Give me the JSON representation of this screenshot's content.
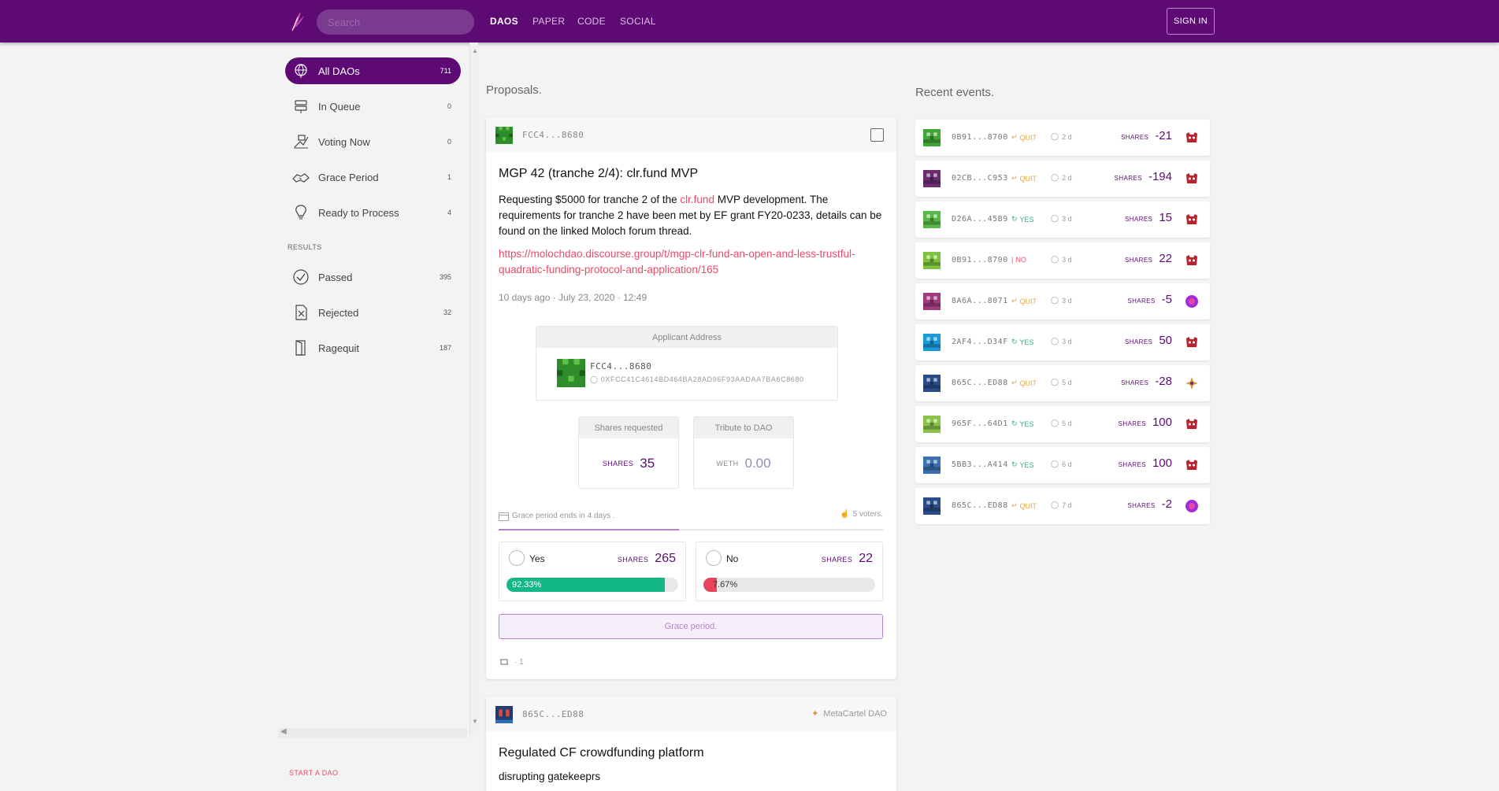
{
  "topbar": {
    "logo_icon": "quill-feather-icon",
    "search_placeholder": "Search",
    "nav": [
      "DAOS",
      "PAPER",
      "CODE",
      "SOCIAL"
    ],
    "sign_in": "SIGN IN",
    "colors": {
      "brand": "#5e0a74"
    }
  },
  "sidebar": {
    "items": [
      {
        "label": "All DAOs",
        "count": "711",
        "icon": "globe-icon",
        "active": true
      },
      {
        "label": "In Queue",
        "count": "0",
        "icon": "signpost-icon"
      },
      {
        "label": "Voting Now",
        "count": "0",
        "icon": "ballot-icon"
      },
      {
        "label": "Grace Period",
        "count": "1",
        "icon": "handshake-icon"
      },
      {
        "label": "Ready to Process",
        "count": "4",
        "icon": "lightbulb-icon"
      }
    ],
    "results_label": "RESULTS",
    "results": [
      {
        "label": "Passed",
        "count": "395",
        "icon": "check-circle-icon"
      },
      {
        "label": "Rejected",
        "count": "32",
        "icon": "rejected-doc-icon"
      },
      {
        "label": "Ragequit",
        "count": "187",
        "icon": "exit-door-icon"
      }
    ],
    "start_dao": "START A DAO"
  },
  "proposals": {
    "title": "Proposals.",
    "first": {
      "address": "FCC4...8680",
      "title": "MGP 42 (tranche 2/4): clr.fund MVP",
      "desc_before": "Requesting $5000 for tranche 2 of the ",
      "desc_link": "clr.fund",
      "desc_after": " MVP development. The requirements for tranche 2 have been met by EF grant FY20-0233, details can be found on the linked Moloch forum thread.",
      "link": "https://molochdao.discourse.group/t/mgp-clr-fund-an-open-and-less-trustful-quadratic-funding-protocol-and-application/165",
      "date": "10 days ago · July 23, 2020 · 12:49",
      "applicant_header": "Applicant Address",
      "applicant_short": "FCC4...8680",
      "applicant_full": "0XFCC41C4614BD464BA28AD96F93AADAA7BA6C8680",
      "shares_requested_label": "Shares requested",
      "shares_unit": "SHARES",
      "shares_requested": "35",
      "tribute_label": "Tribute to DAO",
      "tribute_unit": "WETH",
      "tribute_value": "0.00",
      "grace_text": "Grace period ends in 4 days .",
      "grace_progress": 0.47,
      "voters": "5 voters.",
      "yes_label": "Yes",
      "yes_shares": "265",
      "yes_pct_text": "92.33%",
      "yes_pct": 92.33,
      "no_label": "No",
      "no_shares": "22",
      "no_pct_text": "7.67%",
      "no_pct": 7.67,
      "grace_button": "Grace period.",
      "repost_count": "· 1",
      "colors": {
        "yes": "#13b886",
        "no": "#e8445e",
        "link": "#e64c6a"
      }
    },
    "second": {
      "address": "865C...ED88",
      "dao_name": "MetaCartel DAO",
      "title": "Regulated CF crowdfunding platform",
      "desc": "disrupting gatekeeprs"
    }
  },
  "events": {
    "title": "Recent events.",
    "items": [
      {
        "address": "0B91...8700",
        "kind": "QUIT",
        "time": "2 d",
        "shares": "-21",
        "dao": "moloch-icon",
        "avatar": "#3fa535"
      },
      {
        "address": "02CB...C953",
        "kind": "QUIT",
        "time": "2 d",
        "shares": "-194",
        "dao": "moloch-icon",
        "avatar": "#6a2c6f"
      },
      {
        "address": "D26A...45B9",
        "kind": "YES",
        "time": "3 d",
        "shares": "15",
        "dao": "moloch-icon",
        "avatar": "#58b847"
      },
      {
        "address": "0B91...8700",
        "kind": "NO",
        "time": "3 d",
        "shares": "22",
        "dao": "moloch-icon",
        "avatar": "#7ec13e"
      },
      {
        "address": "8A6A...8071",
        "kind": "QUIT",
        "time": "3 d",
        "shares": "-5",
        "dao": "purple-orb-icon",
        "avatar": "#a23a7e"
      },
      {
        "address": "2AF4...D34F",
        "kind": "YES",
        "time": "3 d",
        "shares": "50",
        "dao": "moloch-icon",
        "avatar": "#1a9ad6"
      },
      {
        "address": "865C...ED88",
        "kind": "QUIT",
        "time": "5 d",
        "shares": "-28",
        "dao": "metacartel-icon",
        "avatar": "#2a4c8a"
      },
      {
        "address": "965F...64D1",
        "kind": "YES",
        "time": "5 d",
        "shares": "100",
        "dao": "moloch-icon",
        "avatar": "#8bc34a"
      },
      {
        "address": "5BB3...A414",
        "kind": "YES",
        "time": "6 d",
        "shares": "100",
        "dao": "moloch-icon",
        "avatar": "#3a6fb0"
      },
      {
        "address": "865C...ED88",
        "kind": "QUIT",
        "time": "7 d",
        "shares": "-2",
        "dao": "purple-orb-icon",
        "avatar": "#2a4c8a"
      }
    ]
  }
}
